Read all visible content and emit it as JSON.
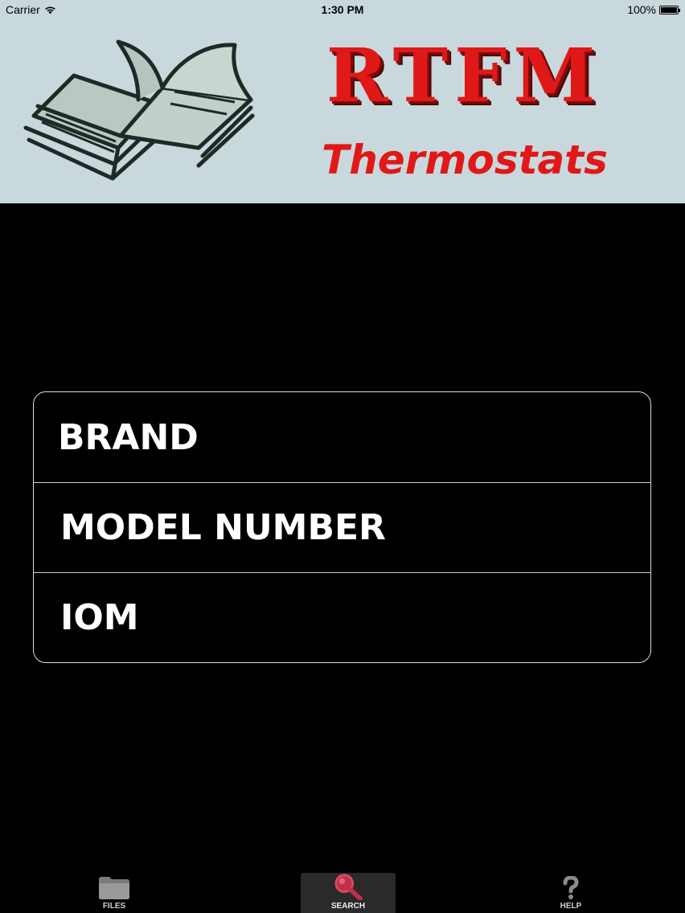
{
  "status_bar": {
    "carrier": "Carrier",
    "time": "1:30 PM",
    "battery": "100%"
  },
  "banner": {
    "title": "RTFM",
    "subtitle": "Thermostats",
    "icon": "open-book-icon"
  },
  "menu": {
    "items": [
      {
        "label": "BRAND"
      },
      {
        "label": "MODEL NUMBER"
      },
      {
        "label": "IOM"
      }
    ]
  },
  "tab_bar": {
    "tabs": [
      {
        "label": "FILES",
        "icon": "folder-icon"
      },
      {
        "label": "SEARCH",
        "icon": "magnifier-icon",
        "selected": true
      },
      {
        "label": "HELP",
        "icon": "question-mark-icon"
      }
    ]
  },
  "colors": {
    "banner_bg": "#c9d8dc",
    "brand_red": "#e01818",
    "background": "#000000"
  }
}
